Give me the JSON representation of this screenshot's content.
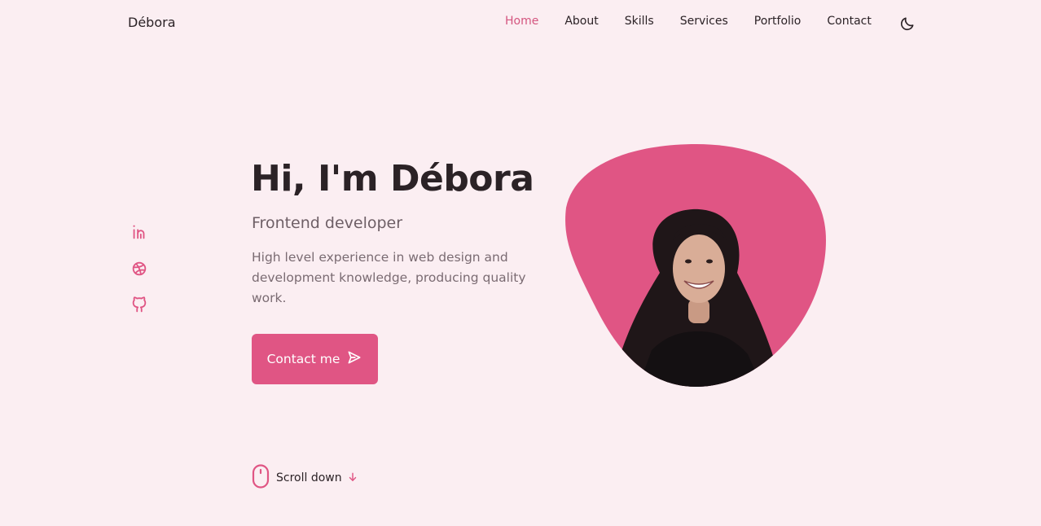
{
  "header": {
    "logo": "Débora",
    "nav": [
      {
        "label": "Home",
        "active": true
      },
      {
        "label": "About",
        "active": false
      },
      {
        "label": "Skills",
        "active": false
      },
      {
        "label": "Services",
        "active": false
      },
      {
        "label": "Portfolio",
        "active": false
      },
      {
        "label": "Contact",
        "active": false
      }
    ],
    "theme_toggle_icon": "moon-icon"
  },
  "social": [
    {
      "icon": "linkedin-icon"
    },
    {
      "icon": "dribbble-icon"
    },
    {
      "icon": "github-icon"
    }
  ],
  "hero": {
    "title": "Hi, I'm Débora",
    "subtitle": "Frontend developer",
    "description": "High level experience in web design and development knowledge, producing quality work.",
    "button_label": "Contact me",
    "button_icon": "send-icon",
    "image_icon": "profile-photo"
  },
  "scroll": {
    "label": "Scroll down",
    "mouse_icon": "mouse-icon",
    "arrow_icon": "arrow-down-icon"
  },
  "colors": {
    "background": "#fbeef2",
    "accent": "#e05584",
    "text": "#2b2226",
    "muted": "#7a6b72"
  }
}
